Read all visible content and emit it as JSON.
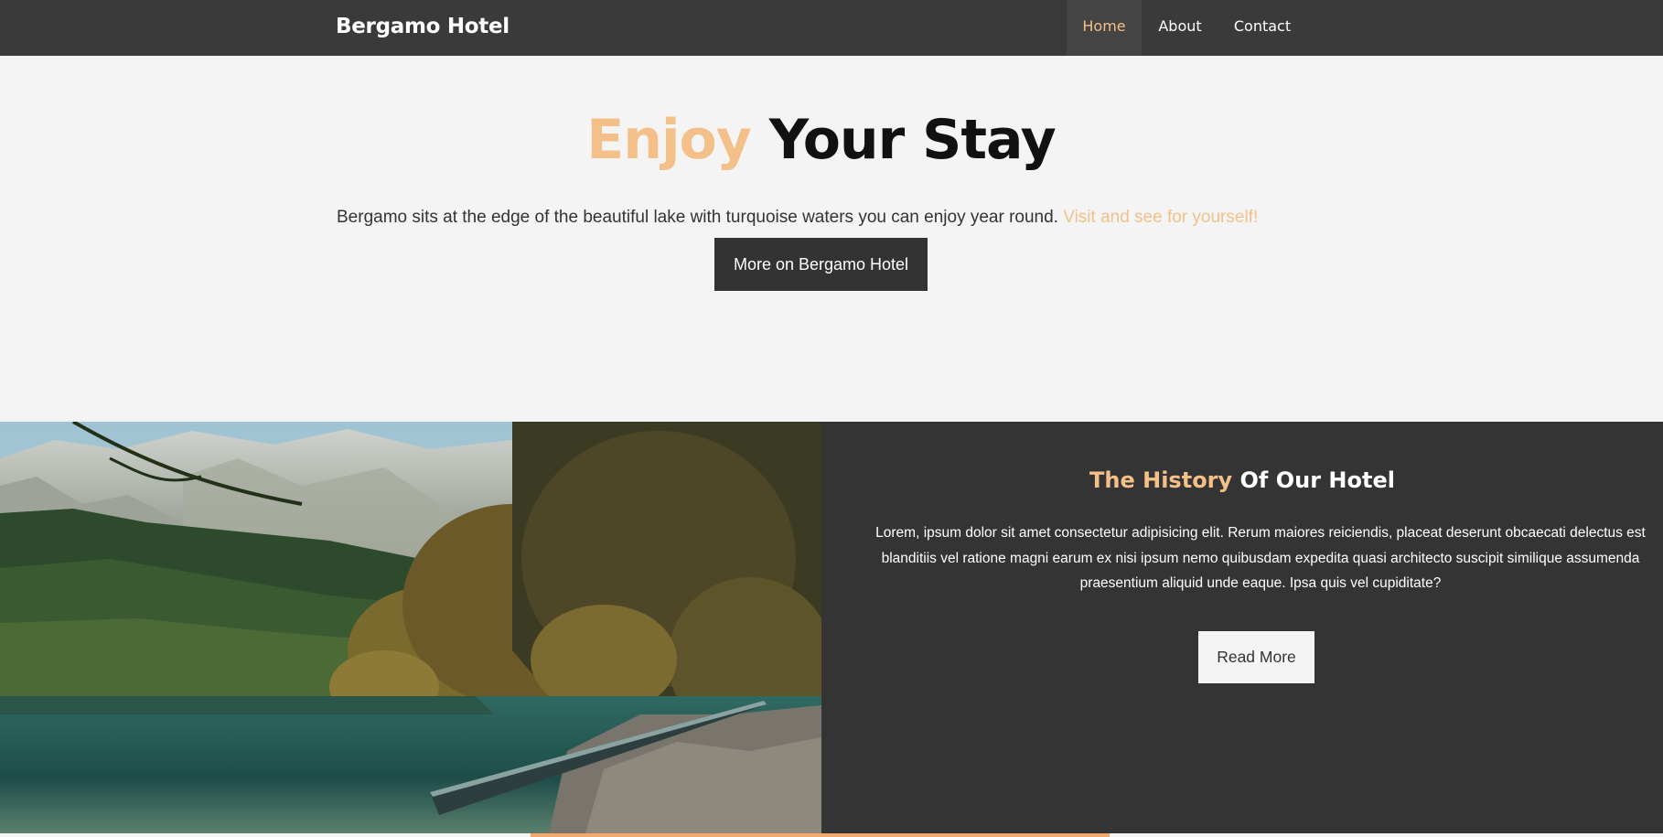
{
  "nav": {
    "brand": "Bergamo Hotel",
    "items": [
      {
        "label": "Home",
        "active": true
      },
      {
        "label": "About",
        "active": false
      },
      {
        "label": "Contact",
        "active": false
      }
    ]
  },
  "hero": {
    "title_accent": "Enjoy",
    "title_rest": " Your Stay",
    "text": "Bergamo sits at the edge of the beautiful lake with turquoise waters you can enjoy year round. ",
    "text_accent": "Visit and see for yourself!",
    "button_label": "More on Bergamo Hotel"
  },
  "history": {
    "title_accent": "The History",
    "title_rest": " Of Our Hotel",
    "text": "Lorem, ipsum dolor sit amet consectetur adipisicing elit. Rerum maiores reiciendis, placeat deserunt obcaecati delectus est blanditiis vel ratione magni earum ex nisi ipsum nemo quibusdam expedita quasi architecto suscipit similique assumenda praesentium aliquid unde eaque. Ipsa quis vel cupiditate?",
    "button_label": "Read More"
  },
  "photo": {
    "subject": "mountain lake with boat and forest"
  },
  "colors": {
    "accent": "#f3c08a",
    "dark": "#353434",
    "navbar": "#3b3a3a",
    "background": "#f4f4f4"
  }
}
